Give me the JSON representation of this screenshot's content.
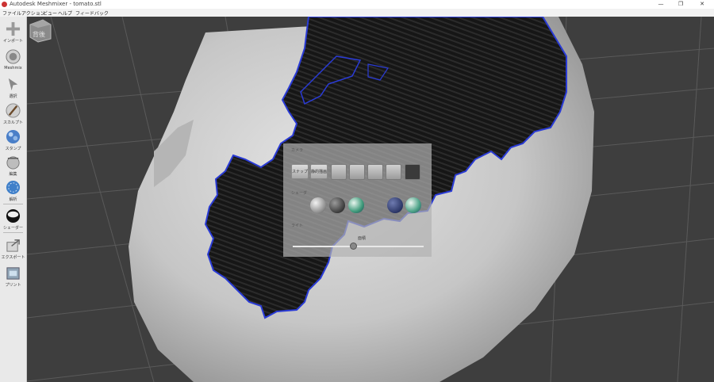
{
  "window": {
    "title": "Autodesk Meshmixer - tomato.stl",
    "minimize": "—",
    "restore": "❐",
    "close": "✕"
  },
  "menu": [
    "ファイル",
    "アクション",
    "ビュー",
    "ヘルプ",
    "フィードバック"
  ],
  "tools": [
    {
      "label": "インポート",
      "icon": "import-plus-icon"
    },
    {
      "label": "Meshmix",
      "icon": "meshmix-icon"
    },
    {
      "label": "選択",
      "icon": "select-arrow-icon"
    },
    {
      "label": "スカルプト",
      "icon": "sculpt-brush-icon"
    },
    {
      "label": "スタンプ",
      "icon": "stamp-icon"
    },
    {
      "label": "編集",
      "icon": "edit-icon"
    },
    {
      "label": "解析",
      "icon": "analysis-icon"
    },
    {
      "label": "シェーダー",
      "icon": "shader-icon"
    },
    {
      "label": "エクスポート",
      "icon": "export-icon"
    },
    {
      "label": "プリント",
      "icon": "print-icon"
    }
  ],
  "navcube": {
    "label": "背後",
    "icon": "view-cube-icon"
  },
  "panel": {
    "section_view": "カメラ",
    "buttons": [
      "スナップ",
      "静的描画"
    ],
    "section_shader": "シェーダ",
    "section_light": "ライト",
    "slider_label": "面積",
    "slider_value": 0.46
  },
  "colors": {
    "accent_blue": "#2a3bd6",
    "mesh_light": "#d9d9d9",
    "background": "#3e3e3e"
  }
}
